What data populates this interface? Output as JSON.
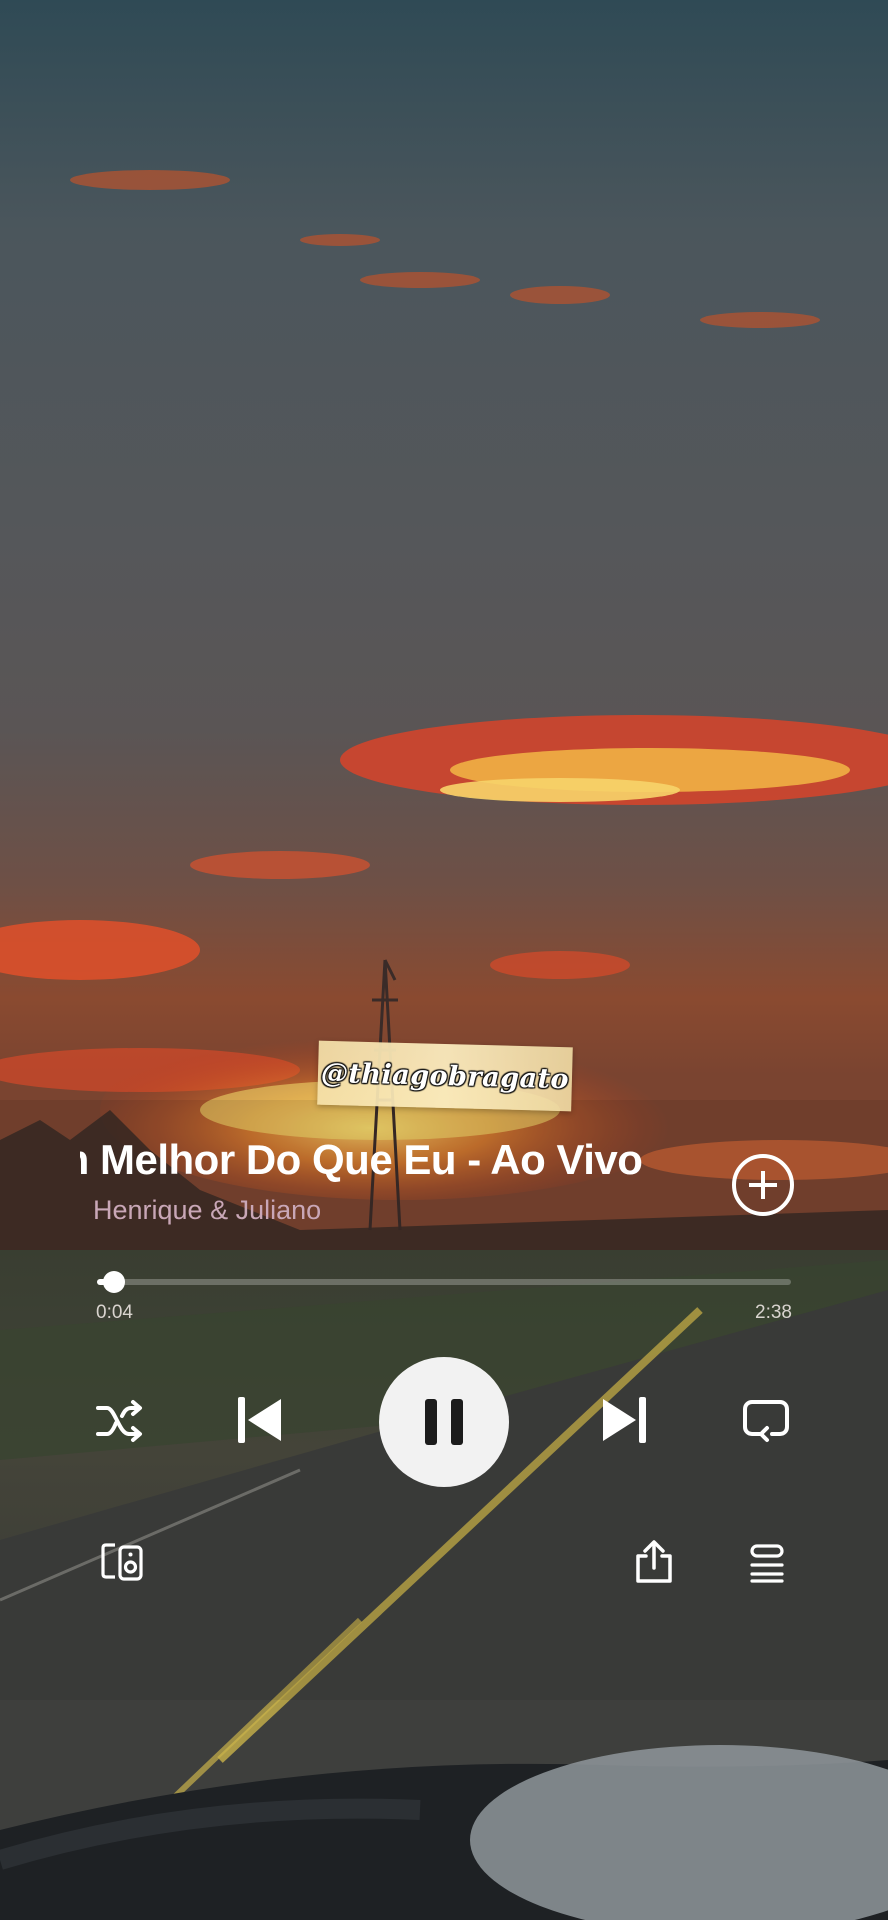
{
  "watermark": "@thiagobragato",
  "track": {
    "title": "m Melhor Do Que Eu - Ao Vivo",
    "artist": "Henrique & Juliano"
  },
  "progress": {
    "elapsed": "0:04",
    "total": "2:38",
    "fraction": 0.025
  },
  "controls": {
    "shuffle_icon": "shuffle-icon",
    "prev_icon": "skip-previous-icon",
    "play_state_icon": "pause-icon",
    "next_icon": "skip-next-icon",
    "repeat_icon": "repeat-icon",
    "add_icon": "add-circle-icon",
    "connect_icon": "device-connect-icon",
    "share_icon": "share-icon",
    "queue_icon": "queue-icon"
  },
  "colors": {
    "artist_text": "#c9a7b7",
    "play_button": "#f2f2f2"
  }
}
